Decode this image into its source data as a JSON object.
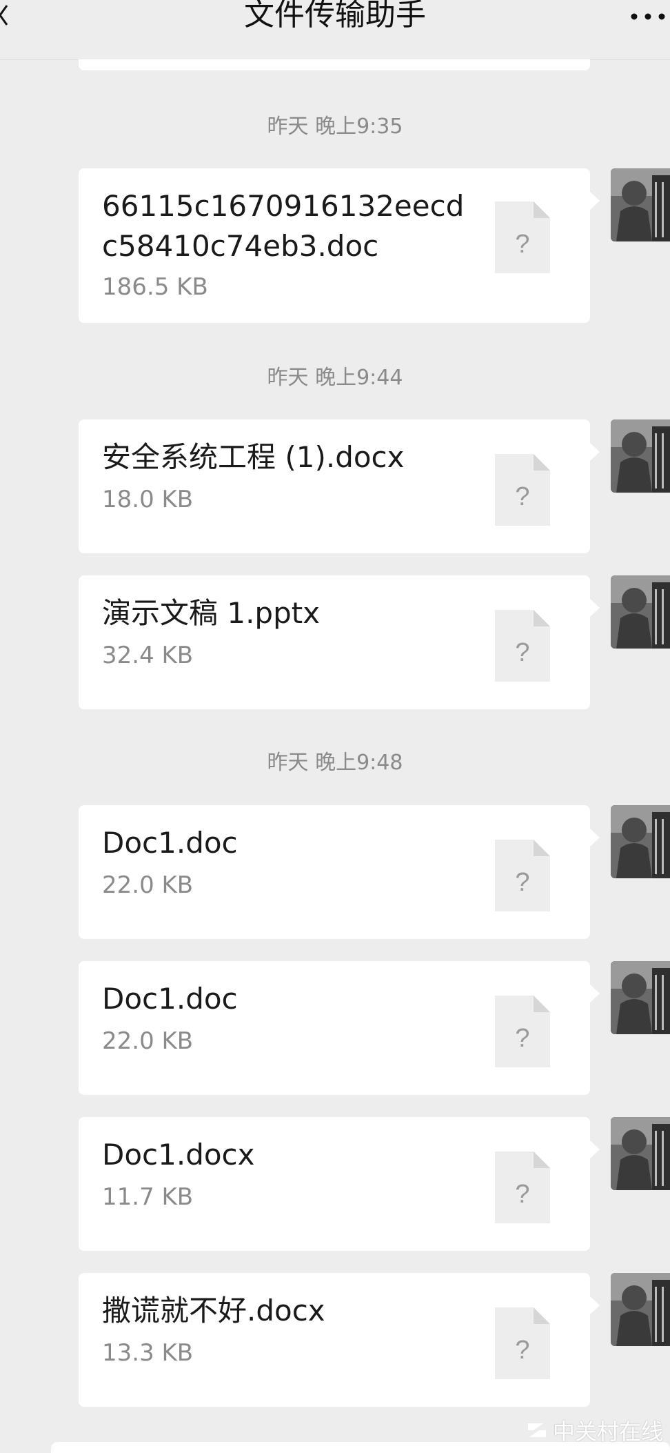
{
  "header": {
    "title": "文件传输助手",
    "back_icon": "chevron-left-icon",
    "more_icon": "more-horizontal-icon"
  },
  "timestamps": {
    "t1": "昨天 晚上9:35",
    "t2": "昨天 晚上9:44",
    "t3": "昨天 晚上9:48"
  },
  "messages": [
    {
      "name": "66115c1670916132eecdc58410c74eb3.doc",
      "size": "186.5 KB"
    },
    {
      "name": "安全系统工程 (1).docx",
      "size": "18.0 KB"
    },
    {
      "name": "演示文稿 1.pptx",
      "size": "32.4 KB"
    },
    {
      "name": "Doc1.doc",
      "size": "22.0 KB"
    },
    {
      "name": "Doc1.doc",
      "size": "22.0 KB"
    },
    {
      "name": "Doc1.docx",
      "size": "11.7 KB"
    },
    {
      "name": "撒谎就不好.docx",
      "size": "13.3 KB"
    }
  ],
  "file_icon_glyph": "?",
  "watermark": {
    "text": "中关村在线",
    "logo": "zol-logo"
  },
  "colors": {
    "background": "#ededed",
    "bubble": "#ffffff",
    "muted_text": "#8a8a8a"
  }
}
